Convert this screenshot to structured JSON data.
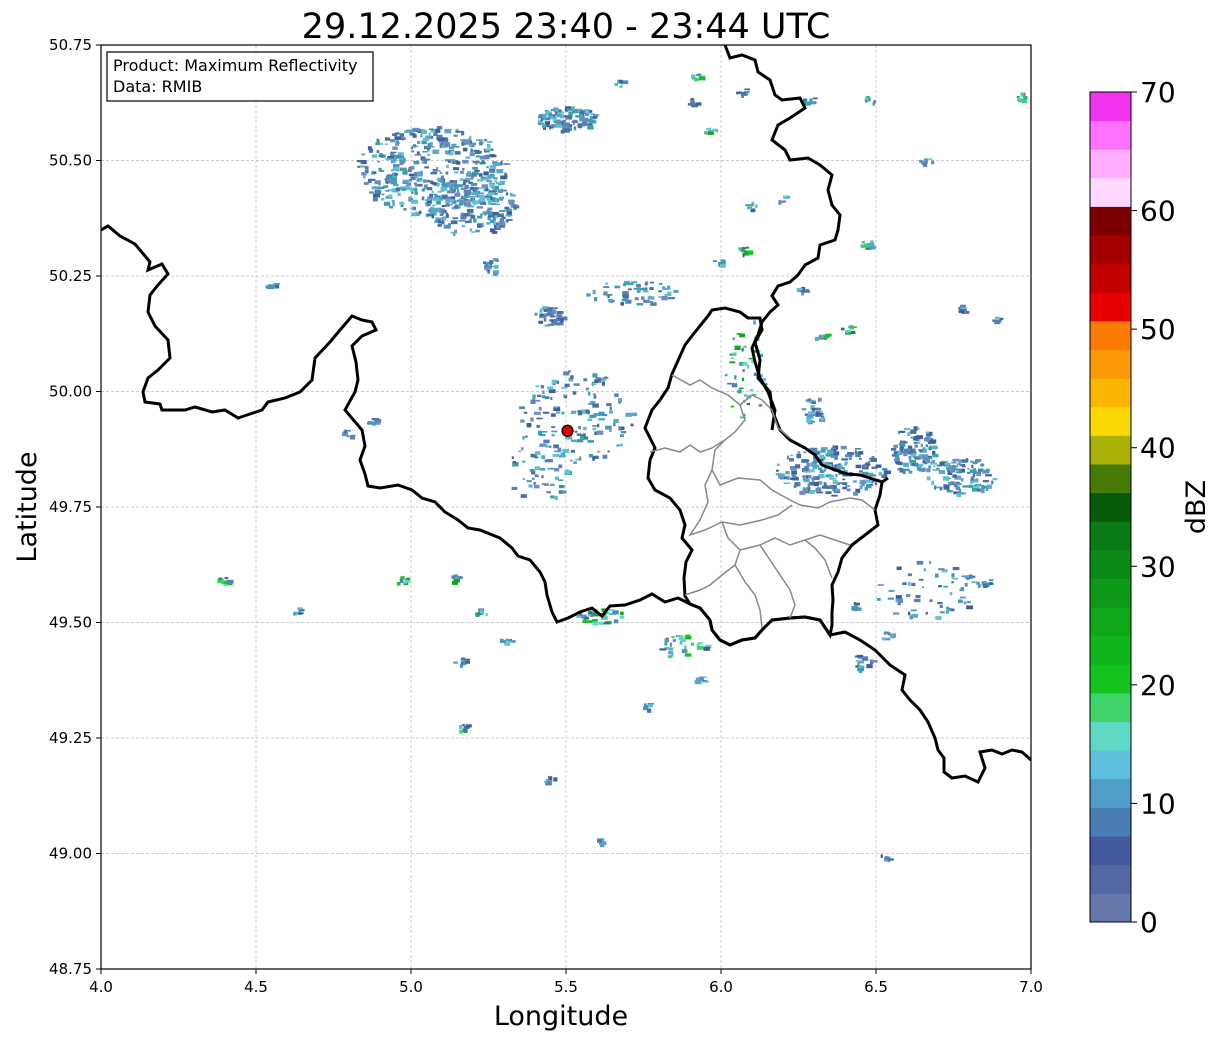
{
  "title": "29.12.2025 23:40 - 23:44 UTC",
  "info": {
    "product": "Product: Maximum Reflectivity",
    "data": "Data: RMIB"
  },
  "xlabel": "Longitude",
  "ylabel": "Latitude",
  "xticks": [
    "4.0",
    "4.5",
    "5.0",
    "5.5",
    "6.0",
    "6.5",
    "7.0"
  ],
  "yticks": [
    "48.75",
    "49.00",
    "49.25",
    "49.50",
    "49.75",
    "50.00",
    "50.25",
    "50.50",
    "50.75"
  ],
  "colorbar": {
    "label": "dBZ",
    "ticks": [
      "0",
      "10",
      "20",
      "30",
      "40",
      "50",
      "60",
      "70"
    ],
    "colors": [
      "#6677aa",
      "#5566a5",
      "#4459a0",
      "#4a7cb5",
      "#519dc9",
      "#5ebedd",
      "#5fd8c4",
      "#3fd46a",
      "#13c41f",
      "#10b61c",
      "#0fa81a",
      "#0d9a18",
      "#0b8a16",
      "#097a14",
      "#055b08",
      "#487a08",
      "#aab004",
      "#fbd704",
      "#fbb604",
      "#fb9904",
      "#fb7a04",
      "#e60000",
      "#c20000",
      "#a40000",
      "#7c0000",
      "#ffd8ff",
      "#ffaeff",
      "#ff72ff",
      "#ef33ef"
    ]
  },
  "map": {
    "lon_range": [
      4.0,
      7.0
    ],
    "lat_range": [
      48.75,
      50.75
    ],
    "radar_site": {
      "lon": 5.505,
      "lat": 49.915
    },
    "grid": true,
    "border_color": "#000000",
    "district_color": "#888888"
  }
}
